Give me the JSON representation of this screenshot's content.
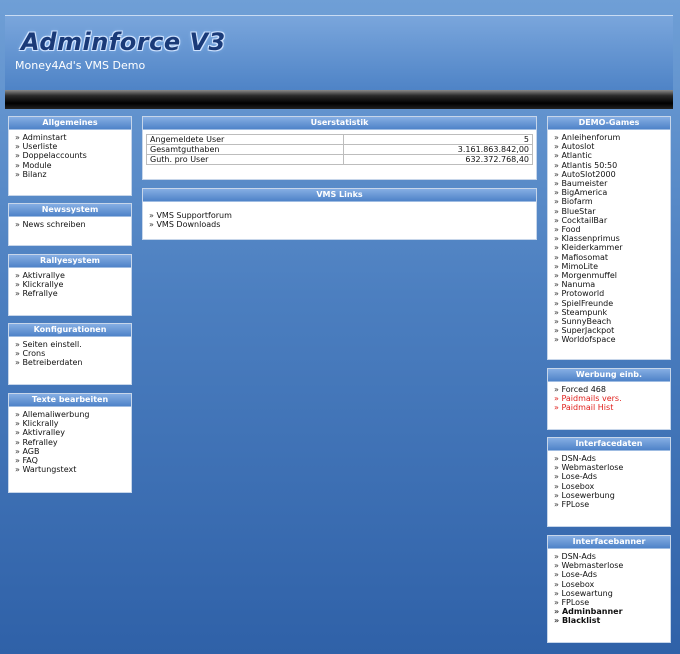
{
  "header": {
    "logo_text": "Adminforce V3",
    "subtitle": "Money4Ad's VMS Demo"
  },
  "left": [
    {
      "key": "allgemeines",
      "title": "Allgemeines",
      "items": [
        "Adminstart",
        "Userliste",
        "Doppelaccounts",
        "Module",
        "Bilanz"
      ]
    },
    {
      "key": "newssystem",
      "title": "Newssystem",
      "items": [
        "News schreiben"
      ]
    },
    {
      "key": "rallyesystem",
      "title": "Rallyesystem",
      "items": [
        "Aktivrallye",
        "Klickrallye",
        "Refrallye"
      ]
    },
    {
      "key": "konfigurationen",
      "title": "Konfigurationen",
      "items": [
        "Seiten einstell.",
        "Crons",
        "Betreiberdaten"
      ]
    },
    {
      "key": "texte",
      "title": "Texte bearbeiten",
      "items": [
        "Allemaliwerbung",
        "Klickrally",
        "Aktivralley",
        "Refralley",
        "AGB",
        "FAQ",
        "Wartungstext"
      ]
    }
  ],
  "center": {
    "userstatistik": {
      "title": "Userstatistik",
      "rows": [
        {
          "label": "Angemeldete User",
          "value": "5"
        },
        {
          "label": "Gesamtguthaben",
          "value": "3.161.863.842,00"
        },
        {
          "label": "Guth. pro User",
          "value": "632.372.768,40"
        }
      ]
    },
    "vms_links": {
      "title": "VMS Links",
      "items": [
        "VMS Supportforum",
        "VMS Downloads"
      ]
    }
  },
  "right": [
    {
      "key": "demo_games",
      "title": "DEMO-Games",
      "items": [
        "Anleihenforum",
        "Autoslot",
        "Atlantic",
        "Atlantis 50:50",
        "AutoSlot2000",
        "Baumeister",
        "BigAmerica",
        "Biofarm",
        "BlueStar",
        "CocktailBar",
        "Food",
        "Klassenprimus",
        "Kleiderkammer",
        "Mafiosomat",
        "MimoLite",
        "Morgenmuffel",
        "Nanuma",
        "Protoworld",
        "SpielFreunde",
        "Steampunk",
        "SunnyBeach",
        "SuperJackpot",
        "Worldofspace"
      ]
    },
    {
      "key": "werbung",
      "title": "Werbung einb.",
      "items": [
        {
          "text": "Forced 468",
          "style": ""
        },
        {
          "text": "Paidmails vers.",
          "style": "red"
        },
        {
          "text": "Paidmail Hist",
          "style": "red"
        }
      ]
    },
    {
      "key": "interfacedaten",
      "title": "Interfacedaten",
      "items": [
        "DSN-Ads",
        "Webmasterlose",
        "Lose-Ads",
        "Losebox",
        "Losewerbung",
        "FPLose"
      ]
    },
    {
      "key": "interfacebanner",
      "title": "Interfacebanner",
      "items": [
        {
          "text": "DSN-Ads",
          "style": ""
        },
        {
          "text": "Webmasterlose",
          "style": ""
        },
        {
          "text": "Lose-Ads",
          "style": ""
        },
        {
          "text": "Losebox",
          "style": ""
        },
        {
          "text": "Losewartung",
          "style": ""
        },
        {
          "text": "FPLose",
          "style": ""
        },
        {
          "text": "Adminbanner",
          "style": "bold"
        },
        {
          "text": "Blacklist",
          "style": "bold"
        }
      ]
    }
  ],
  "colors": {
    "accent": "#4f83c8",
    "link_red": "#e0201c",
    "background": "#4c7fc0"
  }
}
